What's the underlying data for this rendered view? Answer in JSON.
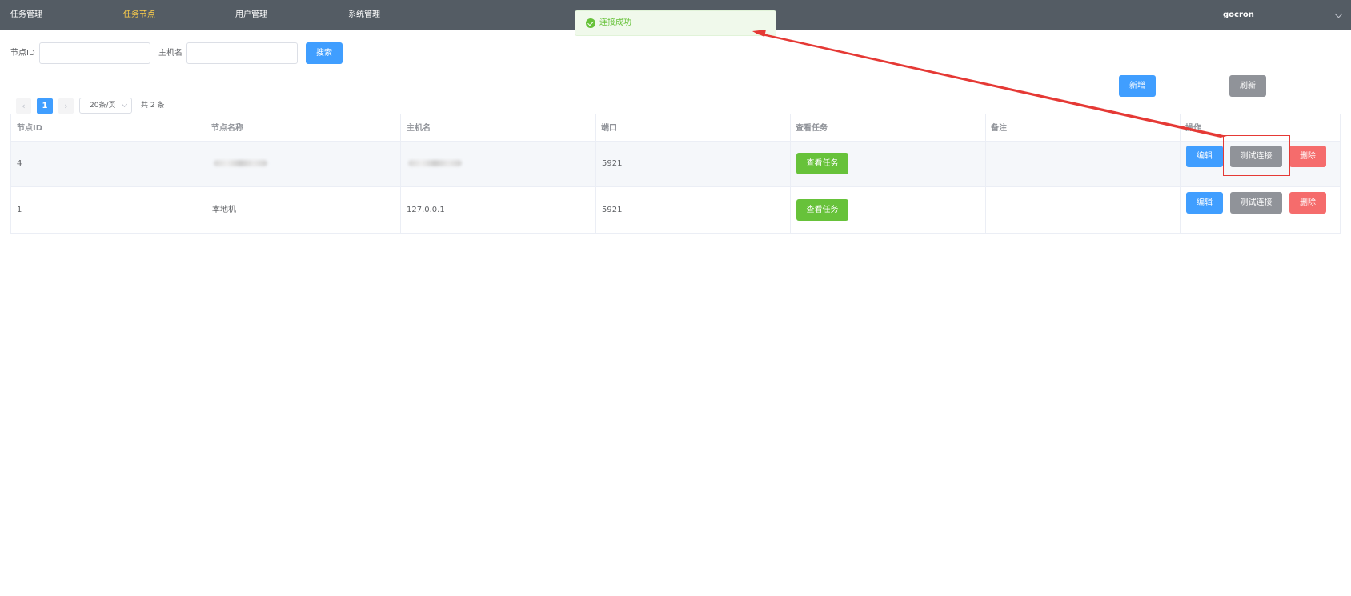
{
  "nav": {
    "items": [
      {
        "label": "任务管理",
        "active": false
      },
      {
        "label": "任务节点",
        "active": true
      },
      {
        "label": "用户管理",
        "active": false
      },
      {
        "label": "系统管理",
        "active": false
      }
    ],
    "user": "gocron",
    "user_icon": "chevron-down-icon"
  },
  "toast": {
    "message": "连接成功",
    "icon": "check-circle-icon",
    "color": "#67c23a"
  },
  "search": {
    "node_id_label": "节点ID",
    "node_id_value": "",
    "hostname_label": "主机名",
    "hostname_value": "",
    "search_button": "搜索"
  },
  "toolbar": {
    "add_button": "新增",
    "refresh_button": "刷新"
  },
  "pagination": {
    "prev_icon": "‹",
    "current_page": "1",
    "next_icon": "›",
    "page_size": "20条/页",
    "total": "共 2 条"
  },
  "table": {
    "columns": [
      "节点ID",
      "节点名称",
      "主机名",
      "端口",
      "查看任务",
      "备注",
      "操作"
    ],
    "rows": [
      {
        "id": "4",
        "name": "",
        "hostname": "",
        "port": "5921",
        "view_tasks": "查看任务",
        "remark": "",
        "edit": "编辑",
        "test": "测试连接",
        "delete": "删除"
      },
      {
        "id": "1",
        "name": "本地机",
        "hostname": "127.0.0.1",
        "port": "5921",
        "view_tasks": "查看任务",
        "remark": "",
        "edit": "编辑",
        "test": "测试连接",
        "delete": "删除"
      }
    ]
  },
  "colors": {
    "nav_bg": "#545c64",
    "nav_active": "#ffd04b",
    "primary": "#409eff",
    "success": "#67c23a",
    "info": "#909399",
    "danger": "#f56c6c",
    "annotation": "#e53935"
  }
}
